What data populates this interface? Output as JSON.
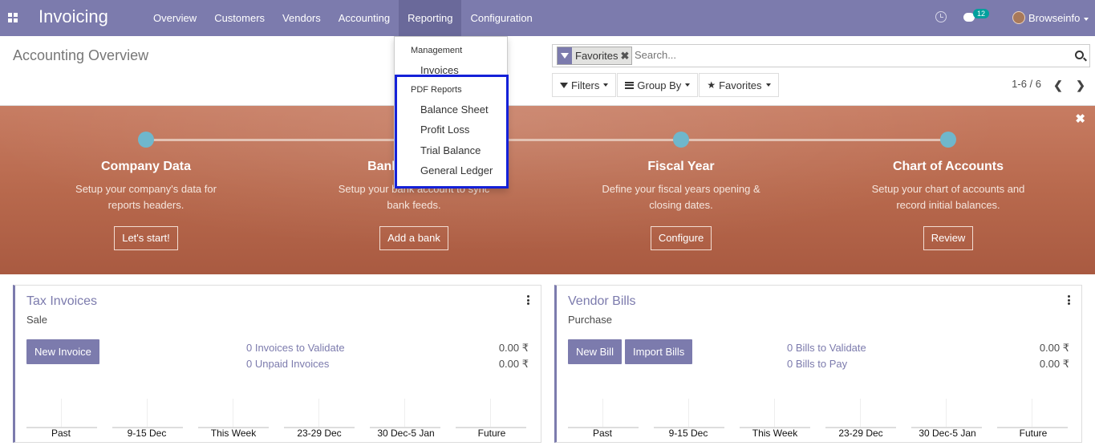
{
  "navbar": {
    "brand": "Invoicing",
    "menu": [
      "Overview",
      "Customers",
      "Vendors",
      "Accounting",
      "Reporting",
      "Configuration"
    ],
    "active_menu": "Reporting",
    "chat_count": "12",
    "user": "Browseinfo"
  },
  "control_panel": {
    "title": "Accounting Overview",
    "facet": "Favorites",
    "search_placeholder": "Search...",
    "filters_label": "Filters",
    "groupby_label": "Group By",
    "favorites_label": "Favorites",
    "pager": "1-6 / 6"
  },
  "reporting_menu": {
    "management_header": "Management",
    "management_items": [
      "Invoices"
    ],
    "pdf_header": "PDF Reports",
    "pdf_items": [
      "Balance Sheet",
      "Profit Loss",
      "Trial Balance",
      "General Ledger"
    ]
  },
  "banner": {
    "steps": [
      {
        "title": "Company Data",
        "desc": "Setup your company's data for reports headers.",
        "button": "Let's start!"
      },
      {
        "title": "Bank Accounts",
        "desc": "Setup your bank account to sync bank feeds.",
        "button": "Add a bank"
      },
      {
        "title": "Fiscal Year",
        "desc": "Define your fiscal years opening & closing dates.",
        "button": "Configure"
      },
      {
        "title": "Chart of Accounts",
        "desc": "Setup your chart of accounts and record initial balances.",
        "button": "Review"
      }
    ]
  },
  "cards": {
    "tax": {
      "title": "Tax Invoices",
      "subtitle": "Sale",
      "buttons": [
        "New Invoice"
      ],
      "links": [
        {
          "label": "0 Invoices to Validate",
          "amount": "0.00 ₹"
        },
        {
          "label": "0 Unpaid Invoices",
          "amount": "0.00 ₹"
        }
      ],
      "axis": [
        "Past",
        "9-15 Dec",
        "This Week",
        "23-29 Dec",
        "30 Dec-5 Jan",
        "Future"
      ]
    },
    "vendor": {
      "title": "Vendor Bills",
      "subtitle": "Purchase",
      "buttons": [
        "New Bill",
        "Import Bills"
      ],
      "links": [
        {
          "label": "0 Bills to Validate",
          "amount": "0.00 ₹"
        },
        {
          "label": "0 Bills to Pay",
          "amount": "0.00 ₹"
        }
      ],
      "axis": [
        "Past",
        "9-15 Dec",
        "This Week",
        "23-29 Dec",
        "30 Dec-5 Jan",
        "Future"
      ]
    }
  },
  "colors": {
    "brand": "#7c7bad",
    "banner": "#b8694d",
    "highlight": "#1421d8"
  }
}
